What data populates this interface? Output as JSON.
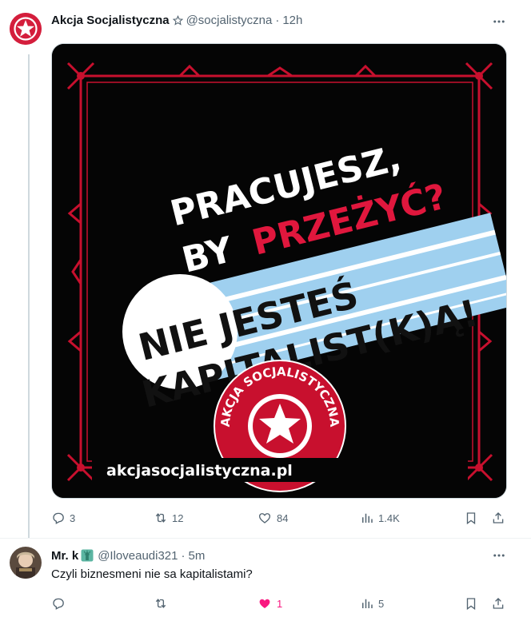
{
  "post": {
    "author_name": "Akcja Socjalistyczna",
    "handle": "@socjalistyczna",
    "separator": "·",
    "time": "12h",
    "verified_icon": "star-outline-icon",
    "media": {
      "line1": "PRACUJESZ,",
      "line2_white": "BY",
      "line2_red": "PRZEŻYĆ?",
      "line3": "NIE JESTEŚ",
      "line4": "KAPITALIST(K)Ą!",
      "badge_text": "AKCJA SOCJALISTYCZNA",
      "url": "akcjasocjalistyczna.pl",
      "colors": {
        "background": "#050505",
        "frame": "#c8102e",
        "accent_red": "#e0173d",
        "stripe_blue": "#9fd0ef"
      }
    },
    "actions": {
      "replies": "3",
      "reposts": "12",
      "likes": "84",
      "views": "1.4K"
    }
  },
  "reply": {
    "author_name": "Mr. k",
    "badge_icon": "statue-of-liberty-emoji",
    "handle": "@Iloveaudi321",
    "separator": "·",
    "time": "5m",
    "text": "Czyli biznesmeni nie sa kapitalistami?",
    "actions": {
      "replies": "",
      "reposts": "",
      "likes": "1",
      "views": "5"
    },
    "liked": true
  },
  "colors": {
    "text_primary": "#0f1419",
    "text_secondary": "#536471",
    "like_active": "#f91880",
    "divider": "#eff3f4"
  }
}
